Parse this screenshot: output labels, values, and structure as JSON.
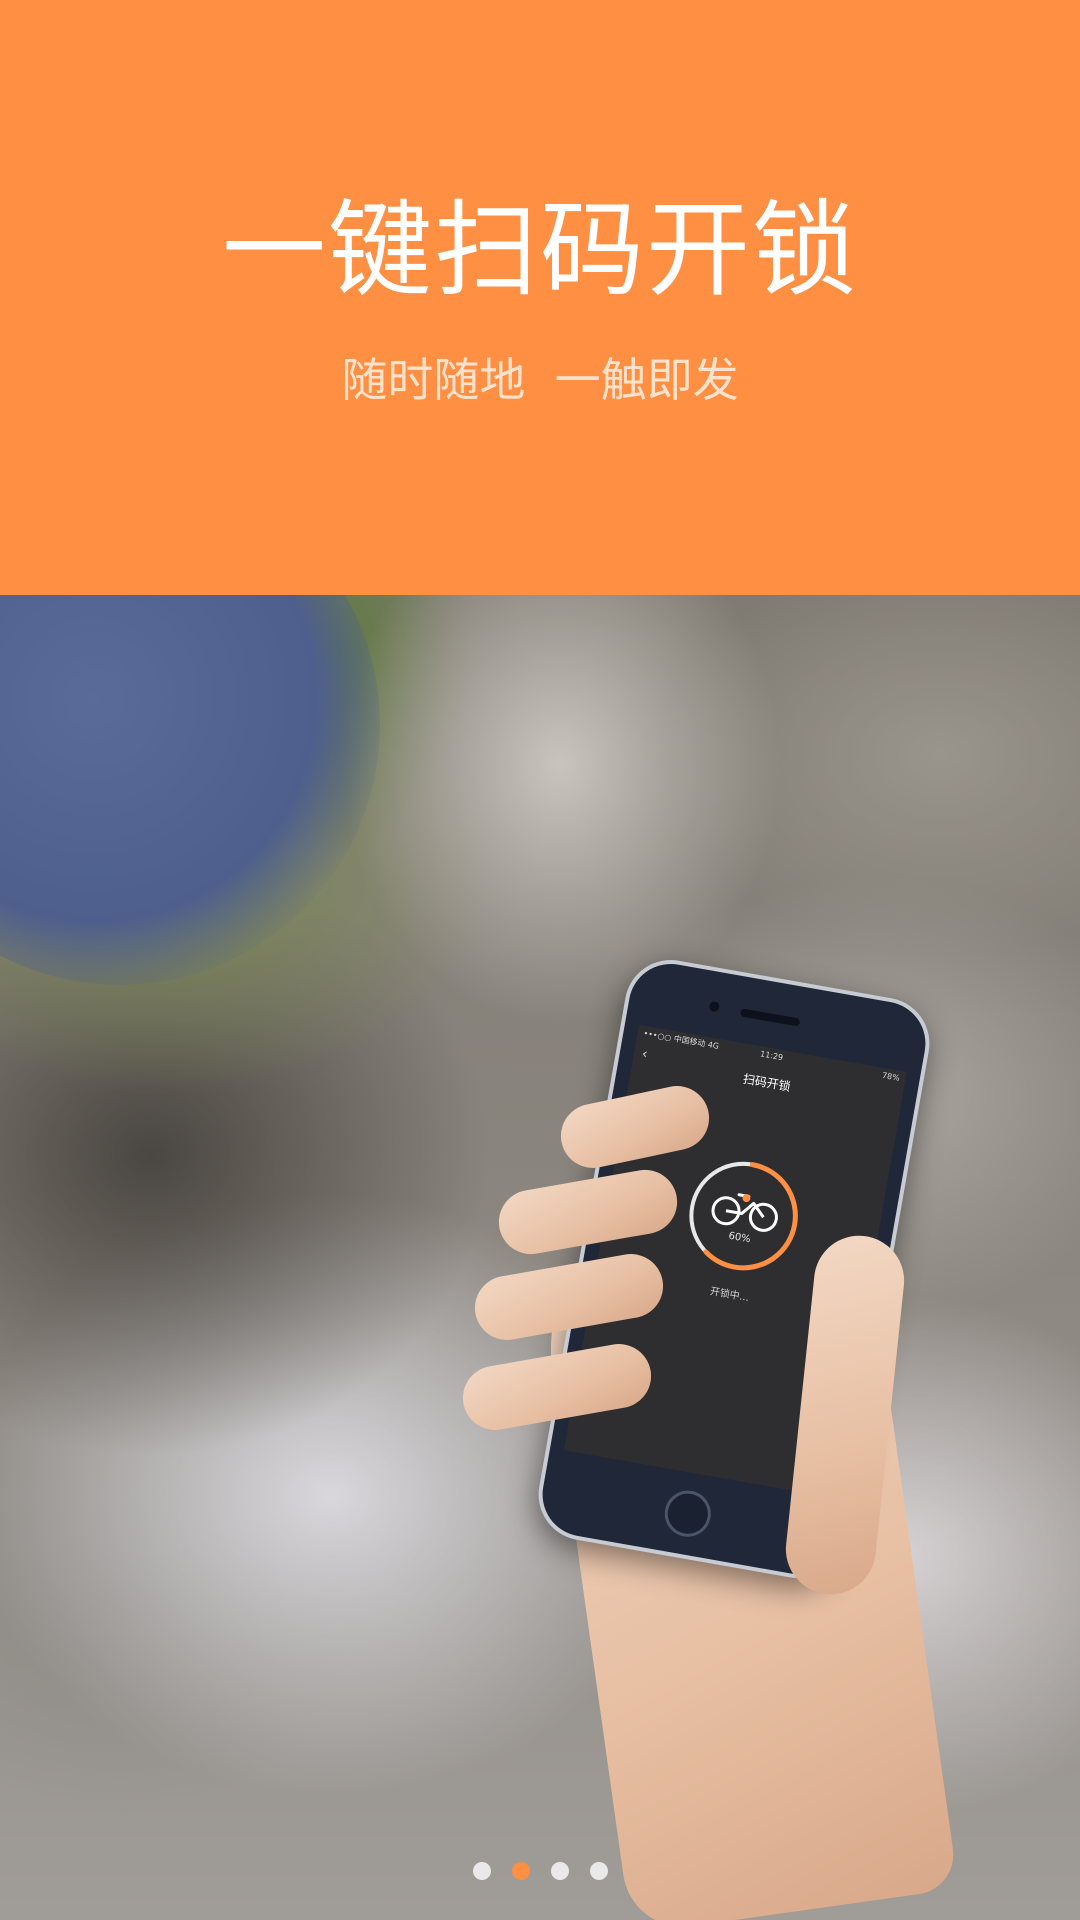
{
  "header": {
    "title": "一键扫码开锁",
    "subtitle": "随时随地  一触即发"
  },
  "phone_screen": {
    "status_carrier": "•••○○ 中国移动 4G",
    "status_time": "11:29",
    "status_battery": "78%",
    "back_icon": "chevron-left-icon",
    "title": "扫码开锁",
    "progress_percent": "60%",
    "progress_value": 0.6,
    "status_text": "开锁中..."
  },
  "pager": {
    "count": 4,
    "active_index": 1
  },
  "colors": {
    "accent": "#FF8F43",
    "subtitle": "#FFE2CC",
    "dot_inactive": "#E9E9E9"
  }
}
